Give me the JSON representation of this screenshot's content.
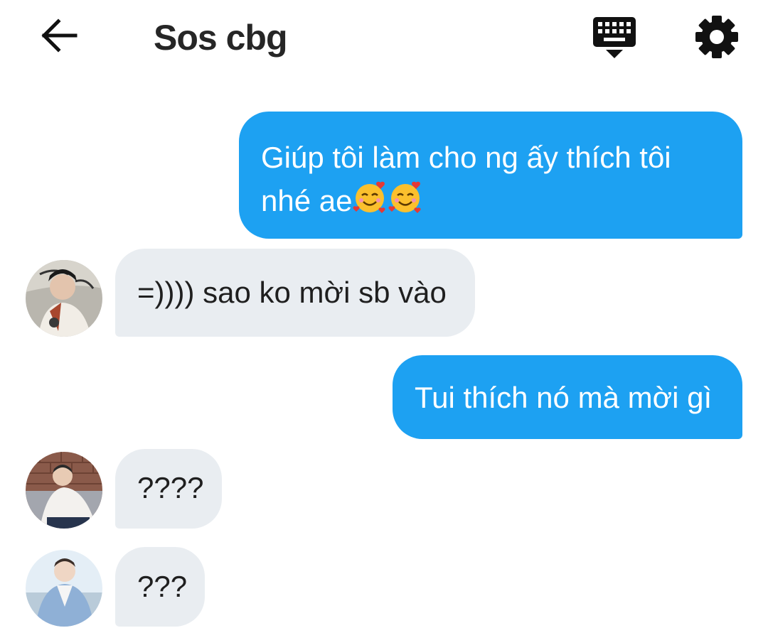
{
  "header": {
    "title": "Sos cbg",
    "back_icon": "arrow-left-icon",
    "keyboard_icon": "keyboard-hide-icon",
    "settings_icon": "gear-icon"
  },
  "colors": {
    "outgoing_bubble": "#1da1f2",
    "incoming_bubble": "#e9edf1",
    "header_text": "#262626"
  },
  "messages": [
    {
      "direction": "outgoing",
      "text_line1": "Giúp tôi làm cho ng ấy thích tôi",
      "text_line2": "nhé ae",
      "emoji": "smiling-face-with-hearts-icon"
    },
    {
      "direction": "incoming",
      "text": "=)))) sao ko mời sb vào",
      "avatar": "avatar-icon"
    },
    {
      "direction": "outgoing",
      "text": "Tui thích nó mà mời gì"
    },
    {
      "direction": "incoming",
      "text": "????",
      "avatar": "avatar-icon"
    },
    {
      "direction": "incoming",
      "text": "???",
      "avatar": "avatar-icon"
    }
  ]
}
